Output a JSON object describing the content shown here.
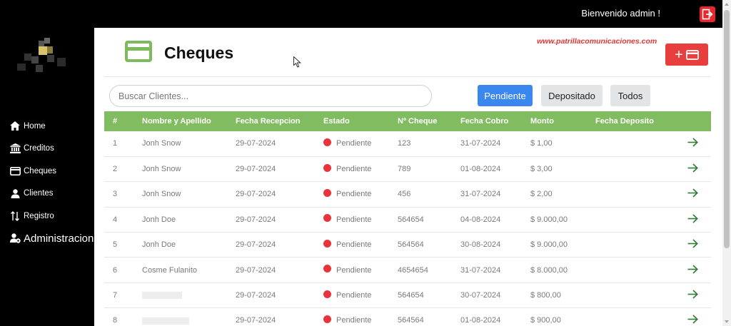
{
  "header": {
    "welcome": "Bienvenido admin !",
    "logout_icon": "logout-icon",
    "accent": "#e8262e"
  },
  "sidebar": {
    "items": [
      {
        "label": "Home",
        "icon": "home-icon"
      },
      {
        "label": "Creditos",
        "icon": "bank-icon"
      },
      {
        "label": "Cheques",
        "icon": "card-icon"
      },
      {
        "label": "Clientes",
        "icon": "user-icon"
      },
      {
        "label": "Registro",
        "icon": "sort-arrows-icon"
      },
      {
        "label": "Administracion",
        "icon": "user-gear-icon"
      }
    ]
  },
  "page": {
    "title": "Cheques",
    "watermark": "www.patrillacomunicaciones.com",
    "add_icon": "add-check-icon",
    "accent": "#7cbb5b"
  },
  "search": {
    "placeholder": "Buscar Clientes..."
  },
  "filters": {
    "pendiente": "Pendiente",
    "depositado": "Depositado",
    "todos": "Todos"
  },
  "table": {
    "columns": [
      "#",
      "Nombre y Apellido",
      "Fecha Recepcion",
      "Estado",
      "Nº Cheque",
      "Fecha Cobro",
      "Monto",
      "Fecha Deposito"
    ],
    "rows": [
      {
        "n": "1",
        "nombre": "Jonh Snow",
        "recepcion": "29-07-2024",
        "estado": "Pendiente",
        "cheque": "123",
        "cobro": "31-07-2024",
        "monto": "$ 1,00",
        "deposito": ""
      },
      {
        "n": "2",
        "nombre": "Jonh Snow",
        "recepcion": "29-07-2024",
        "estado": "Pendiente",
        "cheque": "789",
        "cobro": "01-08-2024",
        "monto": "$ 3,00",
        "deposito": ""
      },
      {
        "n": "3",
        "nombre": "Jonh Snow",
        "recepcion": "29-07-2024",
        "estado": "Pendiente",
        "cheque": "456",
        "cobro": "31-07-2024",
        "monto": "$ 2,00",
        "deposito": ""
      },
      {
        "n": "4",
        "nombre": "Jonh Doe",
        "recepcion": "29-07-2024",
        "estado": "Pendiente",
        "cheque": "564654",
        "cobro": "04-08-2024",
        "monto": "$ 9.000,00",
        "deposito": ""
      },
      {
        "n": "5",
        "nombre": "Jonh Doe",
        "recepcion": "29-07-2024",
        "estado": "Pendiente",
        "cheque": "564564",
        "cobro": "30-08-2024",
        "monto": "$ 9.000,00",
        "deposito": ""
      },
      {
        "n": "6",
        "nombre": "Cosme Fulanito",
        "recepcion": "29-07-2024",
        "estado": "Pendiente",
        "cheque": "4654654",
        "cobro": "31-07-2024",
        "monto": "$ 8.000,00",
        "deposito": ""
      },
      {
        "n": "7",
        "nombre": "",
        "recepcion": "29-07-2024",
        "estado": "Pendiente",
        "cheque": "564654",
        "cobro": "30-07-2024",
        "monto": "$ 800,00",
        "deposito": ""
      },
      {
        "n": "8",
        "nombre": "",
        "recepcion": "29-07-2024",
        "estado": "Pendiente",
        "cheque": "564564",
        "cobro": "01-08-2024",
        "monto": "$ 900,00",
        "deposito": ""
      }
    ],
    "status_color": "#e8333a",
    "row_action_icon": "arrow-right-icon"
  }
}
